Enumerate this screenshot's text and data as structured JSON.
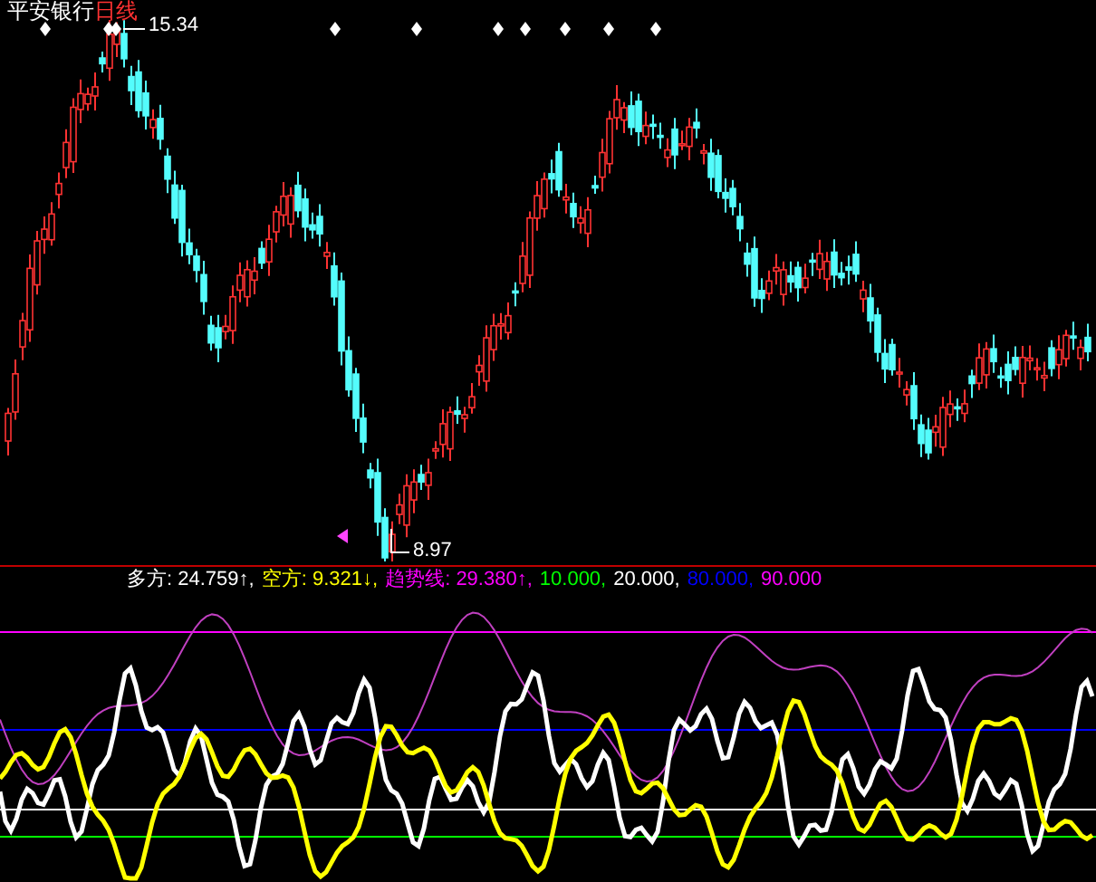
{
  "chart": {
    "stock": "平安银行",
    "period": "日线",
    "high_label": "15.34",
    "low_label": "8.97"
  },
  "indicator": {
    "items": [
      {
        "label": "多方:",
        "value": "24.759",
        "arrow": "↑,",
        "color": "#ffffff"
      },
      {
        "label": "空方:",
        "value": "9.321",
        "arrow": "↓,",
        "color": "#ffff00"
      },
      {
        "label": "趋势线:",
        "value": "29.380",
        "arrow": "↑,",
        "color": "#ff00ff"
      },
      {
        "value": "10.000,",
        "color": "#00ff00"
      },
      {
        "value": "20.000,",
        "color": "#ffffff"
      },
      {
        "value": "80.000,",
        "color": "#0000ff"
      },
      {
        "value": "90.000",
        "color": "#ff00ff"
      }
    ]
  }
}
